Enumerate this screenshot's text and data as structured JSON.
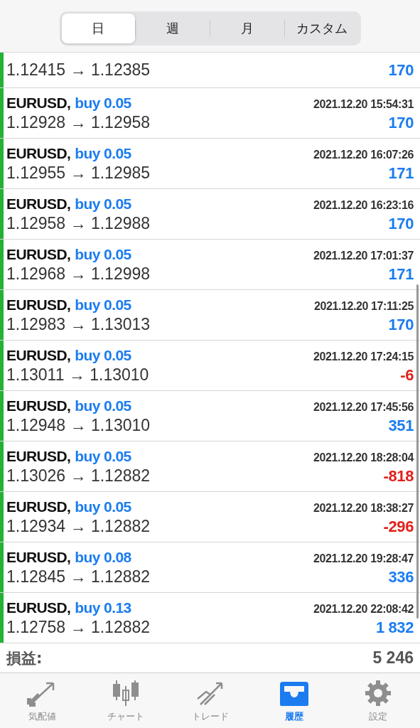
{
  "period_tabs": [
    {
      "label": "日",
      "selected": true
    },
    {
      "label": "週",
      "selected": false
    },
    {
      "label": "月",
      "selected": false
    },
    {
      "label": "カスタム",
      "selected": false
    }
  ],
  "deals": [
    {
      "prices": "1.12415 → 1.12385",
      "profit": "170",
      "loss": false
    },
    {
      "symbol": "EURUSD,",
      "side": "buy 0.05",
      "time": "2021.12.20 15:54:31",
      "prices": "1.12928 → 1.12958",
      "profit": "170",
      "loss": false
    },
    {
      "symbol": "EURUSD,",
      "side": "buy 0.05",
      "time": "2021.12.20 16:07:26",
      "prices": "1.12955 → 1.12985",
      "profit": "171",
      "loss": false
    },
    {
      "symbol": "EURUSD,",
      "side": "buy 0.05",
      "time": "2021.12.20 16:23:16",
      "prices": "1.12958 → 1.12988",
      "profit": "170",
      "loss": false
    },
    {
      "symbol": "EURUSD,",
      "side": "buy 0.05",
      "time": "2021.12.20 17:01:37",
      "prices": "1.12968 → 1.12998",
      "profit": "171",
      "loss": false
    },
    {
      "symbol": "EURUSD,",
      "side": "buy 0.05",
      "time": "2021.12.20 17:11:25",
      "prices": "1.12983 → 1.13013",
      "profit": "170",
      "loss": false
    },
    {
      "symbol": "EURUSD,",
      "side": "buy 0.05",
      "time": "2021.12.20 17:24:15",
      "prices": "1.13011 → 1.13010",
      "profit": "-6",
      "loss": true
    },
    {
      "symbol": "EURUSD,",
      "side": "buy 0.05",
      "time": "2021.12.20 17:45:56",
      "prices": "1.12948 → 1.13010",
      "profit": "351",
      "loss": false
    },
    {
      "symbol": "EURUSD,",
      "side": "buy 0.05",
      "time": "2021.12.20 18:28:04",
      "prices": "1.13026 → 1.12882",
      "profit": "-818",
      "loss": true
    },
    {
      "symbol": "EURUSD,",
      "side": "buy 0.05",
      "time": "2021.12.20 18:38:27",
      "prices": "1.12934 → 1.12882",
      "profit": "-296",
      "loss": true
    },
    {
      "symbol": "EURUSD,",
      "side": "buy 0.08",
      "time": "2021.12.20 19:28:47",
      "prices": "1.12845 → 1.12882",
      "profit": "336",
      "loss": false
    },
    {
      "symbol": "EURUSD,",
      "side": "buy 0.13",
      "time": "2021.12.20 22:08:42",
      "prices": "1.12758 → 1.12882",
      "profit": "1 832",
      "loss": false
    }
  ],
  "total": {
    "label": "損益:",
    "value": "5 246"
  },
  "nav_tabs": [
    {
      "label": "気配値",
      "kind": "quotes",
      "selected": false
    },
    {
      "label": "チャート",
      "kind": "chart",
      "selected": false
    },
    {
      "label": "トレード",
      "kind": "trade",
      "selected": false
    },
    {
      "label": "履歴",
      "kind": "history",
      "selected": true
    },
    {
      "label": "設定",
      "kind": "settings",
      "selected": false
    }
  ]
}
